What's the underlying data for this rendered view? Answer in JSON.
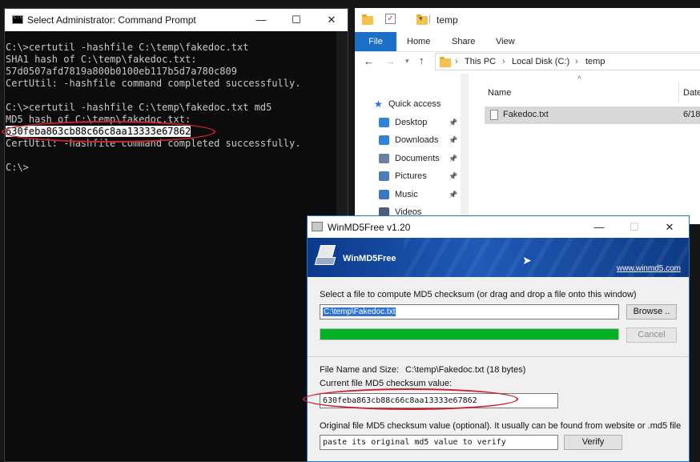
{
  "cmd": {
    "title": "Select Administrator: Command Prompt",
    "lines": [
      "C:\\>certutil -hashfile C:\\temp\\fakedoc.txt",
      "SHA1 hash of C:\\temp\\fakedoc.txt:",
      "57d0507afd7819a800b0100eb117b5d7a780c809",
      "CertUtil: -hashfile command completed successfully.",
      "",
      "C:\\>certutil -hashfile C:\\temp\\fakedoc.txt md5",
      "MD5 hash of C:\\temp\\fakedoc.txt:",
      "630feba863cb88c66c8aa13333e67862",
      "CertUtil: -hashfile command completed successfully.",
      "",
      "C:\\>"
    ],
    "highlight_line": 7
  },
  "window_controls": {
    "minimize": "—",
    "maximize": "☐",
    "close": "✕"
  },
  "explorer": {
    "title": "temp",
    "ribbon_tabs": [
      "File",
      "Home",
      "Share",
      "View"
    ],
    "breadcrumb": [
      "This PC",
      "Local Disk (C:)",
      "temp"
    ],
    "nav": [
      {
        "label": "Quick access",
        "icon": "star-icon",
        "color": "#2c73c9",
        "pinned": false
      },
      {
        "label": "Desktop",
        "icon": "desktop-icon",
        "color": "#2f86d8",
        "pinned": true
      },
      {
        "label": "Downloads",
        "icon": "download-icon",
        "color": "#2f86d8",
        "pinned": true
      },
      {
        "label": "Documents",
        "icon": "documents-icon",
        "color": "#6e7fa3",
        "pinned": true
      },
      {
        "label": "Pictures",
        "icon": "pictures-icon",
        "color": "#4d7db8",
        "pinned": true
      },
      {
        "label": "Music",
        "icon": "music-icon",
        "color": "#3a78c4",
        "pinned": true
      },
      {
        "label": "Videos",
        "icon": "videos-icon",
        "color": "#4f5d77",
        "pinned": false
      }
    ],
    "columns": {
      "name": "Name",
      "date": "Date"
    },
    "files": [
      {
        "name": "Fakedoc.txt",
        "date": "6/18"
      }
    ]
  },
  "md5": {
    "title": "WinMD5Free v1.20",
    "banner_name": "WinMD5Free",
    "banner_url": "www.winmd5.com",
    "select_label": "Select a file to compute MD5 checksum (or drag and drop a file onto this window)",
    "file_path": "C:\\temp\\Fakedoc.txt",
    "browse": "Browse ..",
    "cancel": "Cancel",
    "progress": 1.0,
    "name_size_label": "File Name and Size:",
    "name_size_value": "C:\\temp\\Fakedoc.txt (18 bytes)",
    "current_label": "Current file MD5 checksum value:",
    "current_value": "630feba863cb88c66c8aa13333e67862",
    "original_label": "Original file MD5 checksum value (optional). It usually can be found from website or .md5 file",
    "original_value": "paste its original md5 value to verify",
    "verify": "Verify"
  }
}
